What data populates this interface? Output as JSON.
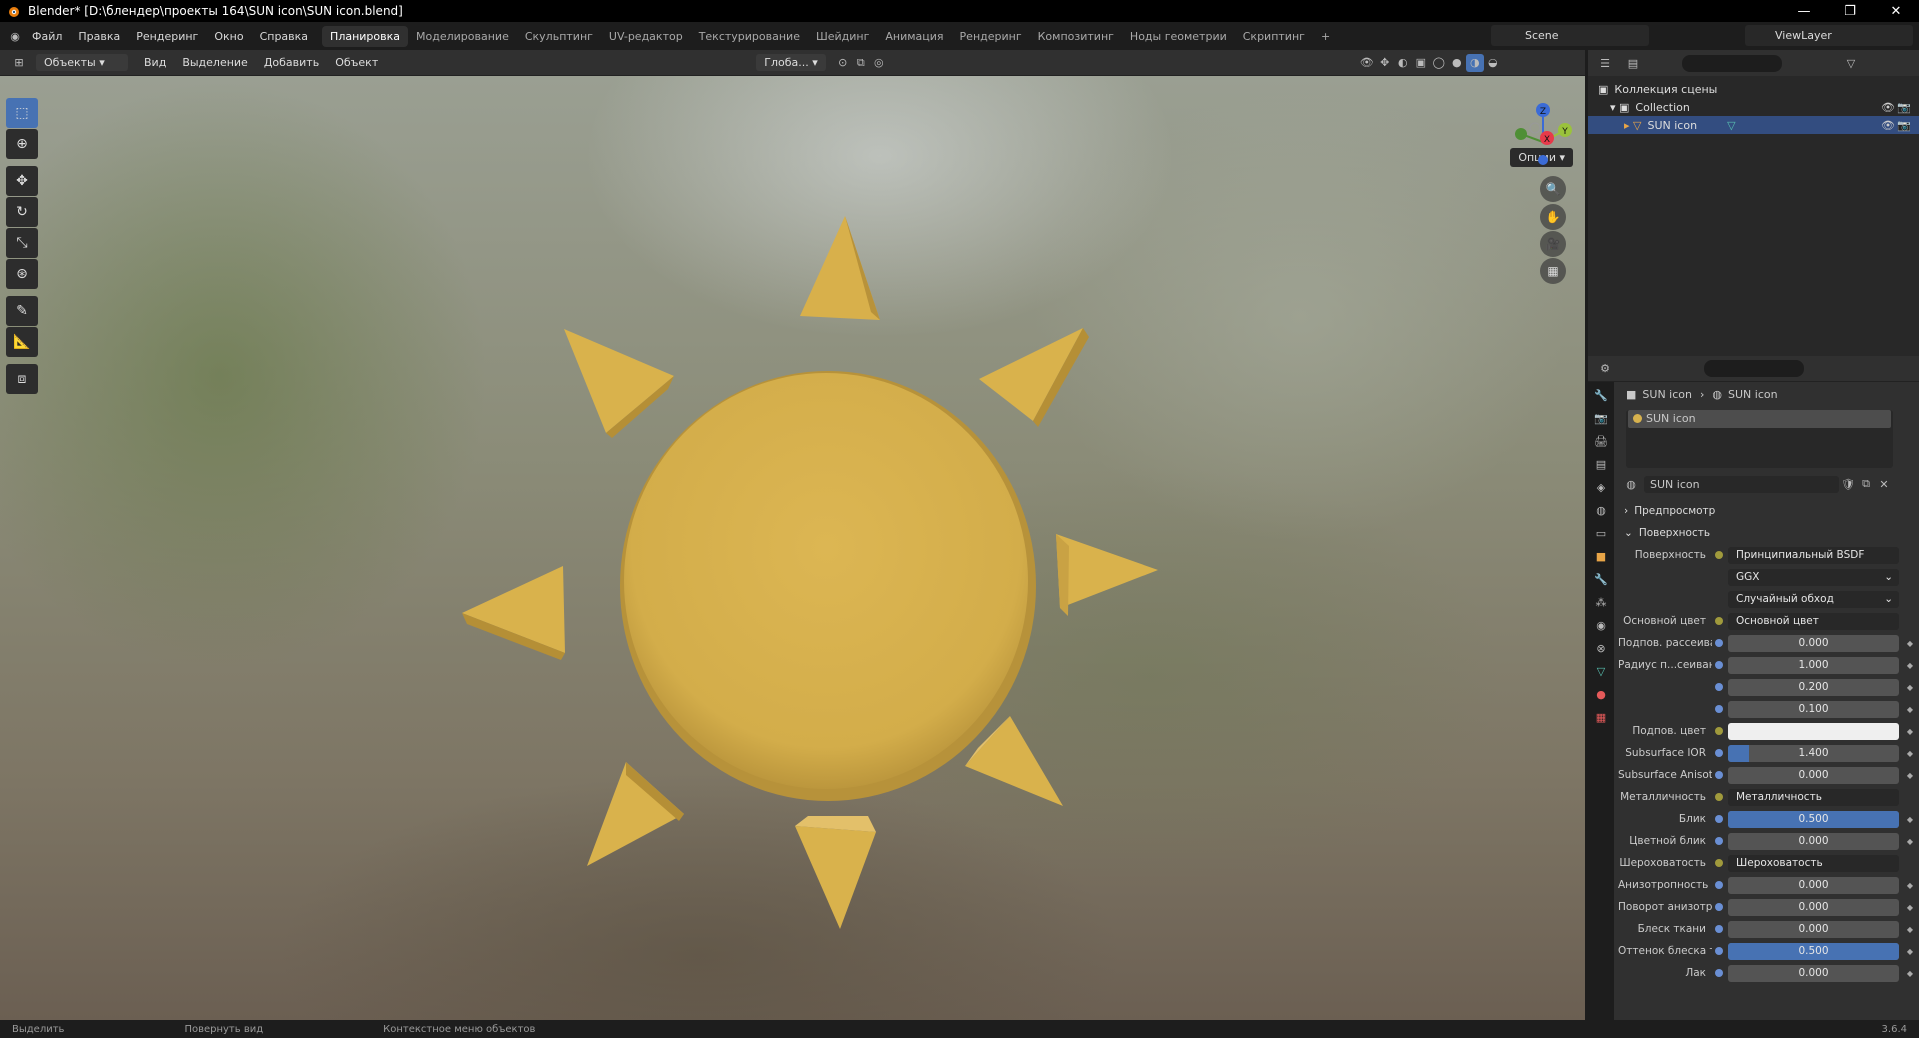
{
  "window": {
    "title": "Blender* [D:\\блендер\\проекты 164\\SUN icon\\SUN icon.blend]"
  },
  "menu": [
    "Файл",
    "Правка",
    "Рендеринг",
    "Окно",
    "Справка"
  ],
  "workspace_tabs": [
    "Планировка",
    "Моделирование",
    "Скульптинг",
    "UV-редактор",
    "Текстурирование",
    "Шейдинг",
    "Анимация",
    "Рендеринг",
    "Композитинг",
    "Ноды геометрии",
    "Скриптинг"
  ],
  "active_tab": "Планировка",
  "scene": "Scene",
  "view_layer": "ViewLayer",
  "viewport": {
    "mode": "Объекты",
    "menus": [
      "Вид",
      "Выделение",
      "Добавить",
      "Объект"
    ],
    "orientation": "Глоба...",
    "options": "Опции",
    "axes": {
      "x": "X",
      "y": "Y",
      "z": "Z"
    }
  },
  "outliner": {
    "root": "Коллекция сцены",
    "collection": "Collection",
    "object": "SUN icon"
  },
  "properties": {
    "breadcrumb": [
      "SUN icon",
      "SUN icon"
    ],
    "slot": "SUN icon",
    "material": "SUN icon",
    "preview": "Предпросмотр",
    "surface_section": "Поверхность",
    "fields": [
      {
        "label": "Поверхность",
        "value": "Принципиальный BSDF",
        "kind": "link"
      },
      {
        "label": "",
        "value": "GGX",
        "kind": "menu"
      },
      {
        "label": "",
        "value": "Случайный обход",
        "kind": "menu"
      },
      {
        "label": "Основной цвет",
        "value": "Основной цвет",
        "kind": "link"
      },
      {
        "label": "Подпов. рассеива...",
        "value": "0.000",
        "kind": "num",
        "fill": 0
      },
      {
        "label": "Радиус п...сеивания",
        "value": "1.000",
        "kind": "num",
        "fill": 0
      },
      {
        "label": "",
        "value": "0.200",
        "kind": "num",
        "fill": 0
      },
      {
        "label": "",
        "value": "0.100",
        "kind": "num",
        "fill": 0
      },
      {
        "label": "Подпов. цвет",
        "value": "",
        "kind": "color"
      },
      {
        "label": "Subsurface IOR",
        "value": "1.400",
        "kind": "num",
        "fill": 0.12
      },
      {
        "label": "Subsurface Anisotr...",
        "value": "0.000",
        "kind": "num",
        "fill": 0
      },
      {
        "label": "Металличность",
        "value": "Металличность",
        "kind": "link"
      },
      {
        "label": "Блик",
        "value": "0.500",
        "kind": "num",
        "fill": 1
      },
      {
        "label": "Цветной блик",
        "value": "0.000",
        "kind": "num",
        "fill": 0
      },
      {
        "label": "Шероховатость",
        "value": "Шероховатость",
        "kind": "link"
      },
      {
        "label": "Анизотропность",
        "value": "0.000",
        "kind": "num",
        "fill": 0
      },
      {
        "label": "Поворот анизотро...",
        "value": "0.000",
        "kind": "num",
        "fill": 0
      },
      {
        "label": "Блеск ткани",
        "value": "0.000",
        "kind": "num",
        "fill": 0
      },
      {
        "label": "Оттенок блеска тк...",
        "value": "0.500",
        "kind": "num",
        "fill": 1
      },
      {
        "label": "Лак",
        "value": "0.000",
        "kind": "num",
        "fill": 0
      }
    ]
  },
  "status": [
    "Выделить",
    "Повернуть вид",
    "Контекстное меню объектов"
  ],
  "version": "3.6.4",
  "colors": {
    "sun": "#d7b24e",
    "sun_shade": "#b89235",
    "selection": "#4772b3"
  }
}
